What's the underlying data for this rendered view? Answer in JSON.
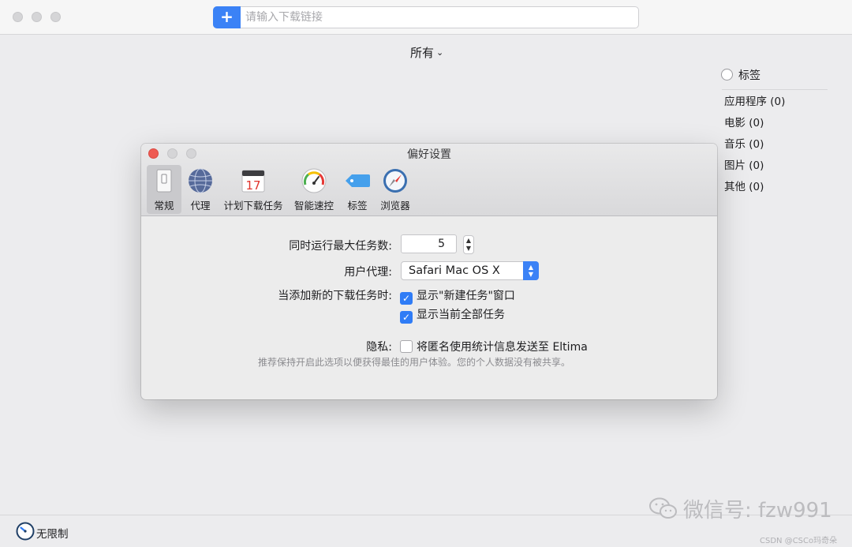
{
  "window": {
    "url_placeholder": "请输入下载链接",
    "add_button": "+",
    "filter_label": "所有",
    "filter_chevron": "⌄"
  },
  "tags": {
    "header": "标签",
    "items": [
      {
        "label": "应用程序 (0)"
      },
      {
        "label": "电影 (0)"
      },
      {
        "label": "音乐 (0)"
      },
      {
        "label": "图片 (0)"
      },
      {
        "label": "其他 (0)"
      }
    ]
  },
  "status": {
    "speed_label": "无限制"
  },
  "watermark": {
    "text": "微信号: fzw991",
    "footer": "CSDN @CSCo玛奇朵"
  },
  "dialog": {
    "title": "偏好设置",
    "tabs": [
      {
        "label": "常规",
        "icon": "switch-icon",
        "active": true
      },
      {
        "label": "代理",
        "icon": "globe-icon"
      },
      {
        "label": "计划下载任务",
        "icon": "calendar-icon",
        "calendar_day": "17"
      },
      {
        "label": "智能速控",
        "icon": "speedometer-icon"
      },
      {
        "label": "标签",
        "icon": "tag-icon"
      },
      {
        "label": "浏览器",
        "icon": "compass-icon"
      }
    ],
    "max_tasks_label": "同时运行最大任务数:",
    "max_tasks_value": "5",
    "user_agent_label": "用户代理:",
    "user_agent_value": "Safari Mac OS X",
    "on_add_label": "当添加新的下载任务时:",
    "show_new_task_window": {
      "label": "显示\"新建任务\"窗口",
      "checked": true
    },
    "show_all_tasks": {
      "label": "显示当前全部任务",
      "checked": true
    },
    "privacy_label": "隐私:",
    "anonymous_stats": {
      "label": "将匿名使用统计信息发送至 Eltima",
      "checked": false
    },
    "privacy_hint": "推荐保持开启此选项以便获得最佳的用户体验。您的个人数据没有被共享。"
  },
  "colors": {
    "accent": "#2f7cf6",
    "close": "#ee5a52",
    "traffic_inactive": "#d5d5d7"
  }
}
